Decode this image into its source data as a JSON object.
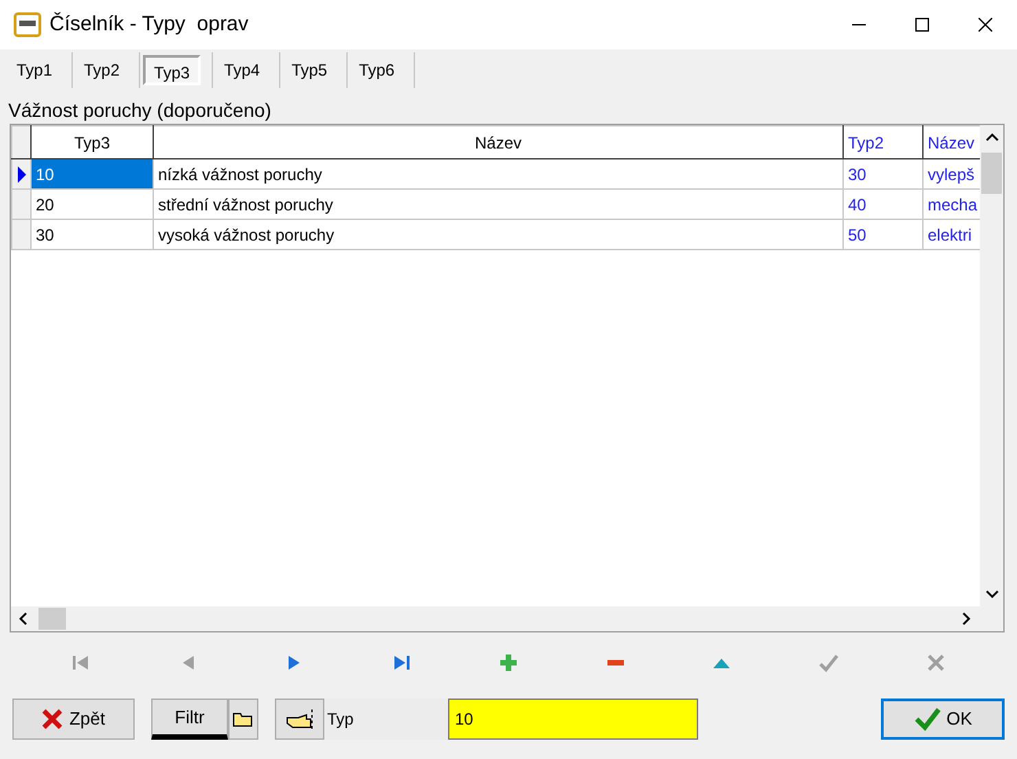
{
  "window": {
    "title": "Číselník - Typy  oprav"
  },
  "tabs": [
    {
      "label": "Typ1",
      "selected": false
    },
    {
      "label": "Typ2",
      "selected": false
    },
    {
      "label": "Typ3",
      "selected": true
    },
    {
      "label": "Typ4",
      "selected": false
    },
    {
      "label": "Typ5",
      "selected": false
    },
    {
      "label": "Typ6",
      "selected": false
    }
  ],
  "section_title": "Vážnost poruchy (doporučeno)",
  "table": {
    "columns": [
      {
        "label": "Typ3",
        "kind": "own"
      },
      {
        "label": "Název",
        "kind": "own"
      },
      {
        "label": "Typ2",
        "kind": "lookup"
      },
      {
        "label": "Název",
        "kind": "lookup"
      }
    ],
    "rows": [
      {
        "cells": [
          "10",
          "nízká vážnost poruchy",
          "30",
          "vylepš"
        ],
        "selected": true
      },
      {
        "cells": [
          "20",
          "střední vážnost poruchy",
          "40",
          "mecha"
        ],
        "selected": false
      },
      {
        "cells": [
          "30",
          "vysoká vážnost poruchy",
          "50",
          "elektri"
        ],
        "selected": false
      }
    ]
  },
  "navigator": [
    {
      "kind": "first",
      "disabled": true
    },
    {
      "kind": "prior",
      "disabled": true
    },
    {
      "kind": "next",
      "disabled": false
    },
    {
      "kind": "last",
      "disabled": false
    },
    {
      "kind": "insert",
      "disabled": false
    },
    {
      "kind": "delete",
      "disabled": false
    },
    {
      "kind": "edit",
      "disabled": false
    },
    {
      "kind": "post",
      "disabled": true
    },
    {
      "kind": "cancel",
      "disabled": true
    }
  ],
  "bottom": {
    "back_button": "Zpět",
    "filter_button": "Filtr",
    "field_label": "Typ",
    "field_value": "10",
    "ok_button": "OK"
  }
}
